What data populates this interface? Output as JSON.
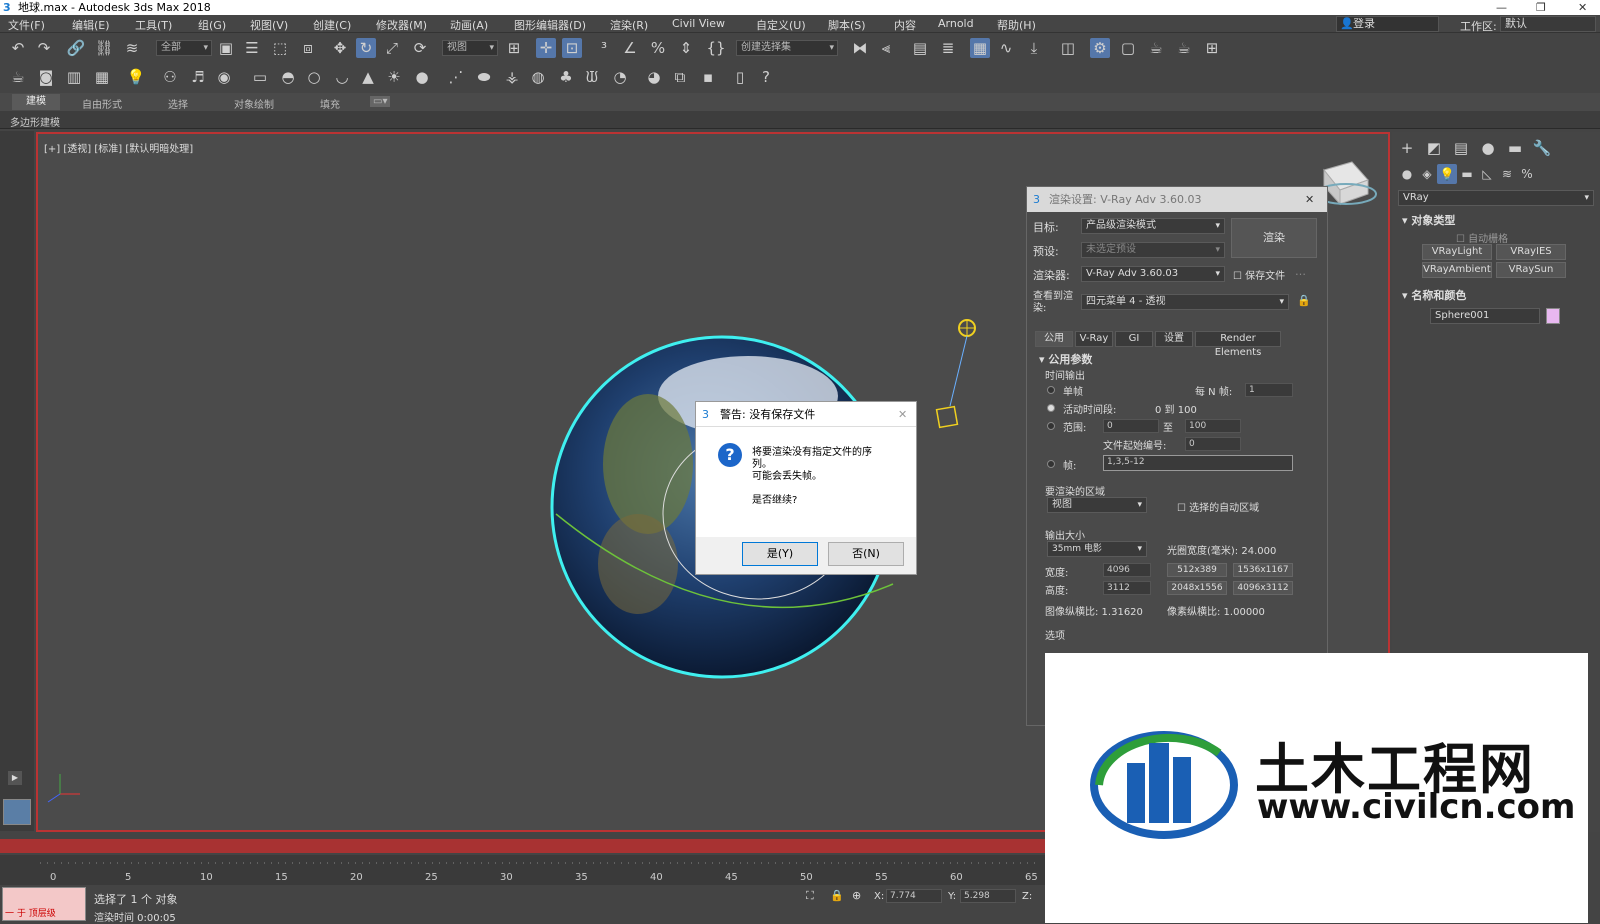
{
  "titlebar": {
    "title": "地球.max - Autodesk 3ds Max 2018"
  },
  "menu": [
    "文件(F)",
    "编辑(E)",
    "工具(T)",
    "组(G)",
    "视图(V)",
    "创建(C)",
    "修改器(M)",
    "动画(A)",
    "图形编辑器(D)",
    "渲染(R)",
    "Civil View",
    "自定义(U)",
    "脚本(S)",
    "内容",
    "Arnold",
    "帮助(H)"
  ],
  "account": {
    "login": "登录",
    "workspace_label": "工作区:",
    "workspace_value": "默认"
  },
  "toolbar": {
    "selection_filter": "全部",
    "ref_coord": "视图",
    "named_selection": "创建选择集"
  },
  "ribbon": {
    "tabs": [
      "建模",
      "自由形式",
      "选择",
      "对象绘制",
      "填充"
    ],
    "sub_label": "多边形建模"
  },
  "viewport": {
    "label": "[+] [透视] [标准] [默认明暗处理]"
  },
  "command_panel": {
    "renderer_dropdown": "VRay",
    "object_type_title": "对象类型",
    "auto_grid": "自动栅格",
    "buttons": [
      "VRayLight",
      "VRayIES",
      "VRayAmbientLight",
      "VRaySun"
    ],
    "name_color_title": "名称和颜色",
    "object_name": "Sphere001",
    "object_color": "#e8b8f0"
  },
  "render_dialog": {
    "title": "渲染设置: V-Ray Adv 3.60.03",
    "target_label": "目标:",
    "target_value": "产品级渲染模式",
    "preset_label": "预设:",
    "preset_value": "未选定预设",
    "renderer_label": "渲染器:",
    "renderer_value": "V-Ray Adv 3.60.03",
    "save_file": "保存文件",
    "render_button": "渲染",
    "view_label": "查看到渲染:",
    "view_value": "四元菜单 4 - 透视",
    "tabs": [
      "公用",
      "V-Ray",
      "GI",
      "设置",
      "Render Elements"
    ],
    "rollout_title": "公用参数",
    "time_output": "时间输出",
    "single": "单帧",
    "every_n_label": "每 N 帧:",
    "every_n_value": "1",
    "active_segment": "活动时间段:",
    "active_range": "0 到 100",
    "range_label": "范围:",
    "range_from": "0",
    "range_to_label": "至",
    "range_to": "100",
    "file_start_label": "文件起始编号:",
    "file_start_value": "0",
    "frames_label": "帧:",
    "frames_value": "1,3,5-12",
    "area_title": "要渲染的区域",
    "area_value": "视图",
    "auto_region": "选择的自动区域",
    "output_size_title": "输出大小",
    "film_value": "35mm 电影",
    "aperture": "光圈宽度(毫米): 24.000",
    "width_label": "宽度:",
    "width_value": "4096",
    "height_label": "高度:",
    "height_value": "3112",
    "presets": [
      "512x389",
      "1536x1167",
      "2048x1556",
      "4096x3112"
    ],
    "aspect": "图像纵横比: 1.31620",
    "pixel_aspect": "像素纵横比: 1.00000",
    "options": "选项"
  },
  "warning": {
    "title": "警告: 没有保存文件",
    "line1": "将要渲染没有指定文件的序",
    "line2": "列。",
    "line3": "可能会丢失帧。",
    "question": "是否继续?",
    "yes": "是(Y)",
    "no": "否(N)"
  },
  "timeline": {
    "ticks": [
      "0",
      "5",
      "10",
      "15",
      "20",
      "25",
      "30",
      "35",
      "40",
      "45",
      "50",
      "55",
      "60",
      "65"
    ]
  },
  "status": {
    "selected": "选择了 1 个 对象",
    "render_time": "渲染时间  0:00:05",
    "mini_label": "一 于 顶层级",
    "x_label": "X:",
    "x_value": "7.774",
    "y_label": "Y:",
    "y_value": "5.298",
    "z_label": "Z:"
  },
  "logo": {
    "cn": "土木工程网",
    "url": "www.civilcn.com"
  }
}
